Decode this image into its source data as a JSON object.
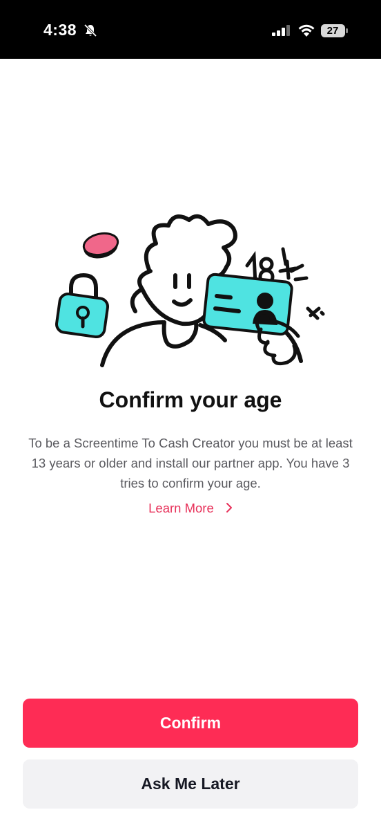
{
  "status_bar": {
    "time": "4:38",
    "battery": "27",
    "icons": [
      "bell-slash-icon",
      "cellular-signal-icon",
      "wifi-icon",
      "battery-icon"
    ]
  },
  "illustration": {
    "badge_text": "18+",
    "colors": {
      "accent_cyan": "#4fe3e1",
      "accent_pink": "#f0678a",
      "outline": "#111111"
    }
  },
  "main": {
    "title": "Confirm your age",
    "description": "To be a Screentime To Cash Creator you must be at least 13 years or older and install our partner app. You have 3 tries to confirm your age.",
    "learn_more_label": "Learn More"
  },
  "actions": {
    "confirm_label": "Confirm",
    "later_label": "Ask Me Later"
  },
  "colors": {
    "primary": "#fe2c55",
    "link": "#e7315a",
    "secondary_button_bg": "#f2f2f4",
    "text_muted": "#5a5a5f"
  }
}
